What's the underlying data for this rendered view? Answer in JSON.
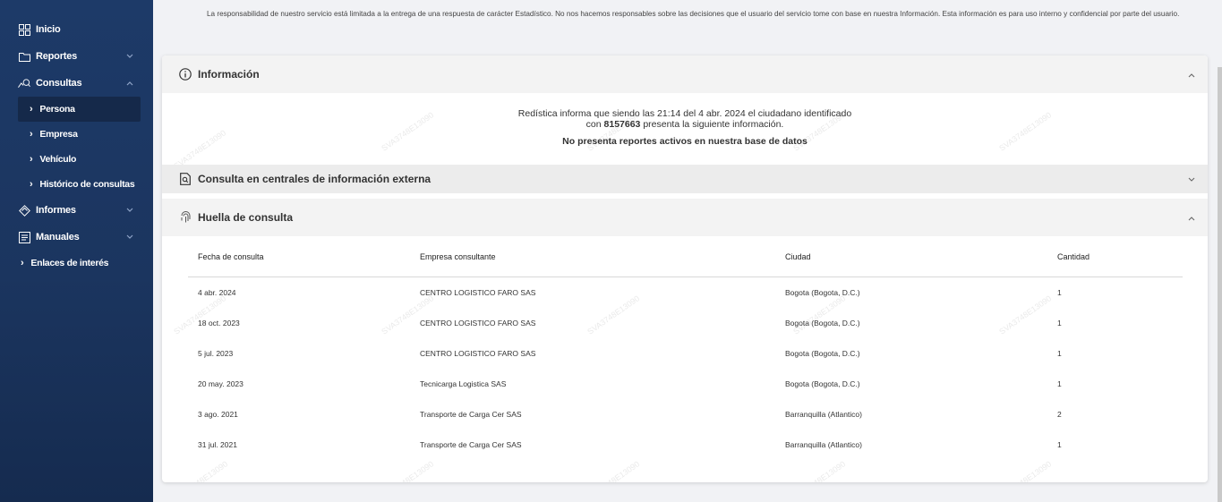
{
  "sidebar": {
    "items": [
      {
        "label": "Inicio",
        "icon": "grid-icon"
      },
      {
        "label": "Reportes",
        "icon": "folder-icon"
      },
      {
        "label": "Consultas",
        "icon": "search-chart-icon"
      }
    ],
    "consultas_sub": [
      {
        "label": "Persona"
      },
      {
        "label": "Empresa"
      },
      {
        "label": "Vehículo"
      },
      {
        "label": "Histórico de consultas"
      }
    ],
    "items2": [
      {
        "label": "Informes",
        "icon": "diamond-icon"
      },
      {
        "label": "Manuales",
        "icon": "book-icon"
      }
    ],
    "enlaces": "Enlaces de interés"
  },
  "disclaimer": "La responsabilidad de nuestro servicio está limitada a la entrega de una respuesta de carácter Estadístico. No nos hacemos responsables sobre las decisiones que el usuario del servicio tome con base en nuestra Información. Esta información es para uso interno y confidencial por parte del usuario.",
  "info": {
    "title": "Información",
    "line1": "Redística informa que siendo las 21:14 del 4 abr. 2024 el ciudadano identificado",
    "line2_pre": "con ",
    "line2_id": "8157663",
    "line2_post": " presenta la siguiente información.",
    "line3": "No presenta reportes activos en nuestra base de datos"
  },
  "external": {
    "title": "Consulta en centrales de información externa"
  },
  "huella": {
    "title": "Huella de consulta",
    "columns": [
      "Fecha de consulta",
      "Empresa consultante",
      "Ciudad",
      "Cantidad"
    ],
    "rows": [
      [
        "4 abr. 2024",
        "CENTRO LOGISTICO FARO SAS",
        "Bogota (Bogota, D.C.)",
        "1"
      ],
      [
        "18 oct. 2023",
        "CENTRO LOGISTICO FARO SAS",
        "Bogota (Bogota, D.C.)",
        "1"
      ],
      [
        "5 jul. 2023",
        "CENTRO LOGISTICO FARO SAS",
        "Bogota (Bogota, D.C.)",
        "1"
      ],
      [
        "20 may. 2023",
        "Tecnicarga Logistica SAS",
        "Bogota (Bogota, D.C.)",
        "1"
      ],
      [
        "3 ago. 2021",
        "Transporte de Carga Cer SAS",
        "Barranquilla (Atlantico)",
        "2"
      ],
      [
        "31 jul. 2021",
        "Transporte de Carga Cer SAS",
        "Barranquilla (Atlantico)",
        "1"
      ]
    ]
  },
  "watermark": "SVA3748E13090",
  "colors": {
    "sidebar": "#1d3a68",
    "active_item": "#15294a"
  }
}
